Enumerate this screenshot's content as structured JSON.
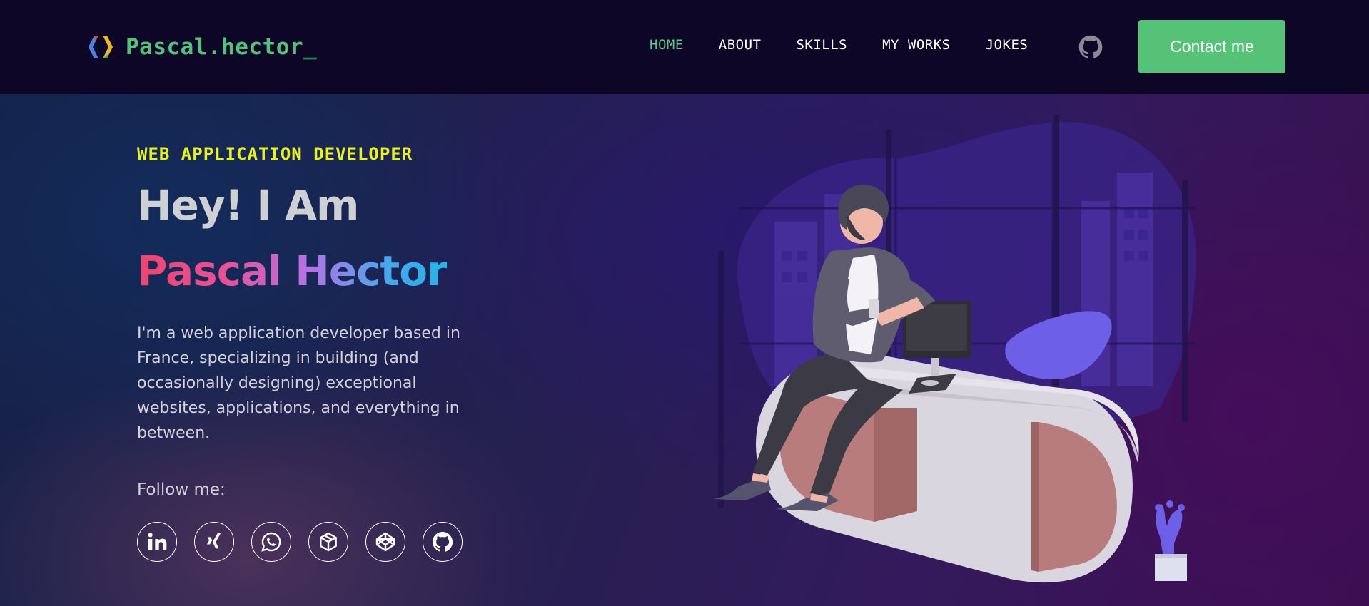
{
  "brand": {
    "name": "Pascal.hector",
    "cursor": "_"
  },
  "nav": {
    "items": [
      {
        "label": "HOME",
        "active": true
      },
      {
        "label": "ABOUT",
        "active": false
      },
      {
        "label": "SKILLS",
        "active": false
      },
      {
        "label": "MY WORKS",
        "active": false
      },
      {
        "label": "JOKES",
        "active": false
      }
    ],
    "github_icon": "github-icon",
    "contact_label": "Contact me"
  },
  "hero": {
    "eyebrow": "WEB APPLICATION DEVELOPER",
    "greeting": "Hey! I Am",
    "name": "Pascal Hector",
    "bio": "I'm a web application developer based in France, specializing in building (and occasionally designing) exceptional websites, applications, and everything in between.",
    "follow_label": "Follow me:",
    "socials": [
      {
        "icon": "linkedin-icon"
      },
      {
        "icon": "xing-icon"
      },
      {
        "icon": "whatsapp-icon"
      },
      {
        "icon": "box-icon"
      },
      {
        "icon": "codepen-icon"
      },
      {
        "icon": "github-icon"
      }
    ]
  },
  "colors": {
    "accent_green": "#55c277",
    "eyebrow_yellow": "#eaf21d",
    "nav_bg": "#0d0626",
    "name_gradient": [
      "#f0436d",
      "#b771e4",
      "#23b4e6"
    ]
  }
}
